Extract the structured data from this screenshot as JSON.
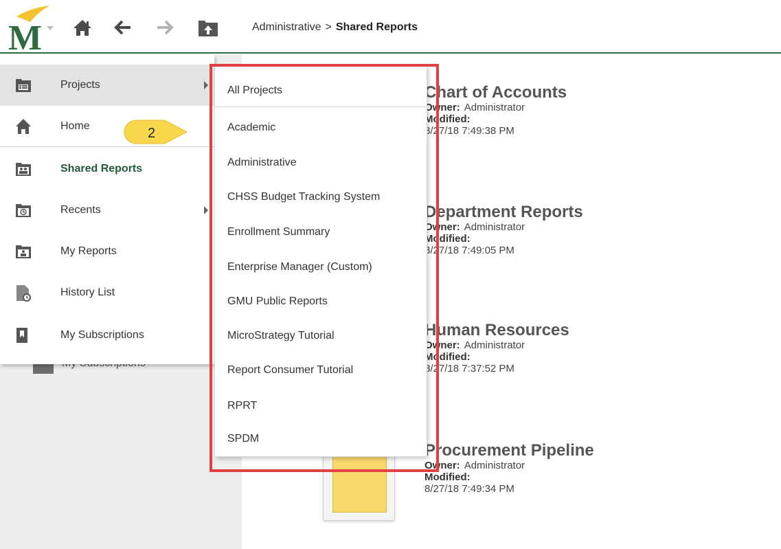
{
  "header": {
    "icons": [
      "logo-m",
      "home-icon",
      "back-arrow-icon",
      "forward-arrow-icon",
      "up-folder-icon"
    ],
    "breadcrumb": {
      "parent": "Administrative",
      "separator": ">",
      "current": "Shared Reports"
    }
  },
  "nav_menu": {
    "items": [
      {
        "label": "Projects",
        "icon": "projects-icon",
        "has_submenu": true,
        "active": true
      },
      {
        "label": "Home",
        "icon": "home-icon",
        "has_submenu": false
      },
      {
        "label": "Shared Reports",
        "icon": "shared-reports-icon",
        "has_submenu": false,
        "selected": true
      },
      {
        "label": "Recents",
        "icon": "recents-icon",
        "has_submenu": true
      },
      {
        "label": "My Reports",
        "icon": "my-reports-icon",
        "has_submenu": false
      },
      {
        "label": "History List",
        "icon": "history-list-icon",
        "has_submenu": false
      },
      {
        "label": "My Subscriptions",
        "icon": "bookmark-icon",
        "has_submenu": false
      }
    ]
  },
  "background_sidebar": {
    "partial_label": "My Subscriptions"
  },
  "callout": {
    "number": "2",
    "color": "#f7d84a"
  },
  "projects_menu": {
    "items": [
      "All Projects",
      "Academic",
      "Administrative",
      "CHSS Budget Tracking System",
      "Enrollment Summary",
      "Enterprise Manager (Custom)",
      "GMU Public Reports",
      "MicroStrategy Tutorial",
      "Report Consumer Tutorial",
      "RPRT",
      "SPDM"
    ],
    "highlight_color": "#e0403f"
  },
  "reports": [
    {
      "title": "Chart of Accounts",
      "owner_label": "Owner:",
      "owner": "Administrator",
      "modified_label": "Modified:",
      "modified": "8/27/18 7:49:38 PM"
    },
    {
      "title": "Department Reports",
      "owner_label": "Owner:",
      "owner": "Administrator",
      "modified_label": "Modified:",
      "modified": "8/27/18 7:49:05 PM"
    },
    {
      "title": "Human Resources",
      "owner_label": "Owner:",
      "owner": "Administrator",
      "modified_label": "Modified:",
      "modified": "8/27/18 7:37:52 PM"
    },
    {
      "title": "Procurement Pipeline",
      "owner_label": "Owner:",
      "owner": "Administrator",
      "modified_label": "Modified:",
      "modified": "8/27/18 7:49:34 PM"
    }
  ],
  "colors": {
    "brand_green": "#2e6b3f",
    "brand_gold": "#f2c230",
    "folder_yellow": "#f7d96b"
  }
}
